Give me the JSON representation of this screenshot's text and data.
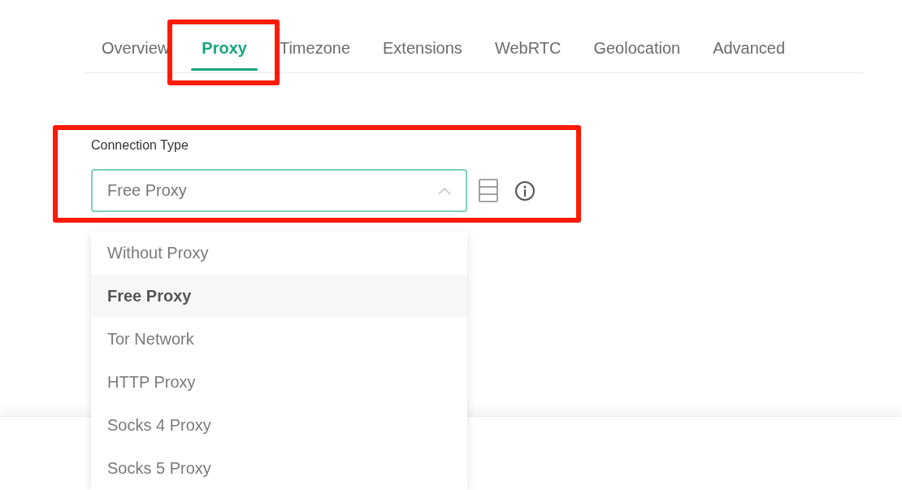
{
  "tabs": [
    {
      "label": "Overview",
      "selected": false,
      "highlighted": false
    },
    {
      "label": "Proxy",
      "selected": true,
      "highlighted": true
    },
    {
      "label": "Timezone",
      "selected": false,
      "highlighted": false
    },
    {
      "label": "Extensions",
      "selected": false,
      "highlighted": false
    },
    {
      "label": "WebRTC",
      "selected": false,
      "highlighted": false
    },
    {
      "label": "Geolocation",
      "selected": false,
      "highlighted": false
    },
    {
      "label": "Advanced",
      "selected": false,
      "highlighted": false
    }
  ],
  "connection_type": {
    "label": "Connection Type",
    "value": "Free Proxy",
    "highlighted": true,
    "expanded": true,
    "options": [
      {
        "label": "Without Proxy",
        "selected": false
      },
      {
        "label": "Free Proxy",
        "selected": true
      },
      {
        "label": "Tor Network",
        "selected": false
      },
      {
        "label": "HTTP Proxy",
        "selected": false
      },
      {
        "label": "Socks 4 Proxy",
        "selected": false
      },
      {
        "label": "Socks 5 Proxy",
        "selected": false
      }
    ]
  }
}
